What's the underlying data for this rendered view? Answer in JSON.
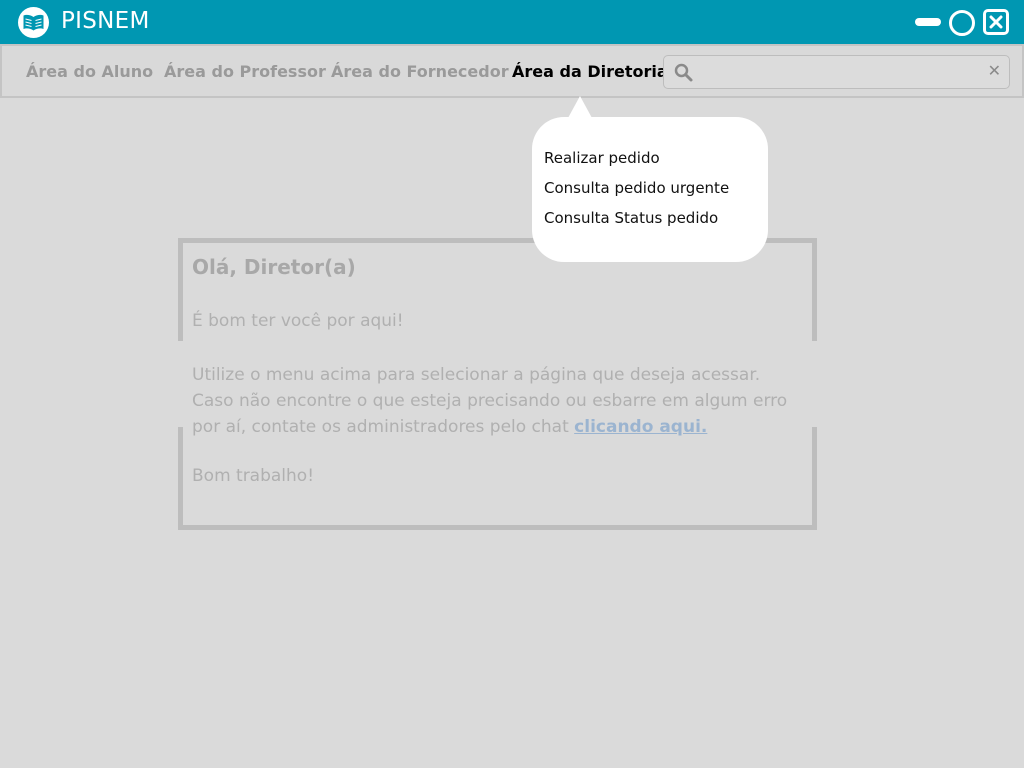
{
  "app": {
    "title": "PISNEM",
    "logo_icon": "book-icon"
  },
  "window_controls": {
    "minimize_icon": "minimize-icon",
    "maximize_icon": "maximize-icon",
    "close_icon": "close-icon"
  },
  "nav": {
    "tabs": [
      {
        "label": "Área do Aluno",
        "active": false
      },
      {
        "label": "Área do Professor",
        "active": false
      },
      {
        "label": "Área do Fornecedor",
        "active": false
      },
      {
        "label": "Área da Diretoria",
        "active": true
      }
    ],
    "search": {
      "placeholder": "",
      "value": "",
      "icon": "search-icon",
      "clear_label": "✕"
    }
  },
  "dropdown": {
    "items": [
      {
        "label": "Realizar pedido"
      },
      {
        "label": "Consulta pedido urgente"
      },
      {
        "label": "Consulta Status pedido"
      }
    ]
  },
  "welcome": {
    "title": "Olá, Diretor(a)",
    "subtitle": "É bom ter você por aqui!",
    "paragraph_text": "Utilize o menu acima para selecionar a página que deseja acessar. Caso não encontre o que esteja precisando ou esbarre em algum erro por aí, contate os administradores pelo chat ",
    "link_text": "clicando aqui.",
    "closing": "Bom trabalho!"
  },
  "colors": {
    "titlebar": "#0097b2",
    "background": "#dadada",
    "link": "#9bb4d0"
  }
}
